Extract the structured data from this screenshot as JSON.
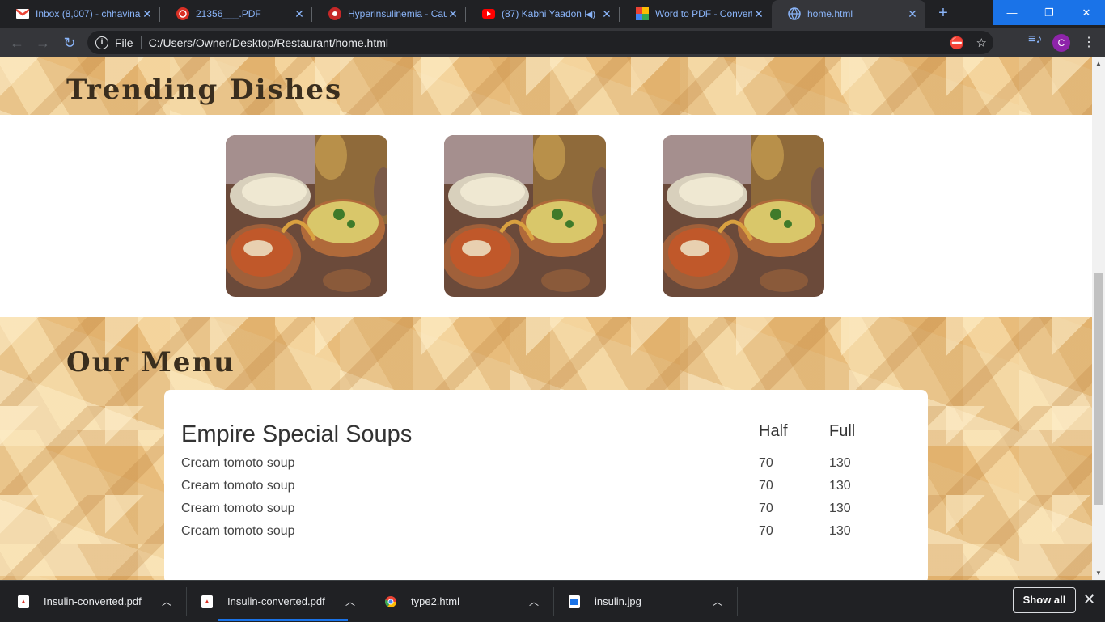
{
  "tabs": [
    {
      "title": "Inbox (8,007) - chhavina",
      "icon": "gmail-icon",
      "active": false
    },
    {
      "title": "21356___.PDF",
      "icon": "pdf-app-icon",
      "active": false
    },
    {
      "title": "Hyperinsulinemia - Cau",
      "icon": "health-site-icon",
      "active": false
    },
    {
      "title": "(87) Kabhi Yaadon M",
      "icon": "youtube-icon",
      "active": false
    },
    {
      "title": "Word to PDF - Convert",
      "icon": "converter-icon",
      "active": false
    },
    {
      "title": "home.html",
      "icon": "globe-icon",
      "active": true
    }
  ],
  "address_bar": {
    "scheme_label": "File",
    "url": "C:/Users/Owner/Desktop/Restaurant/home.html"
  },
  "profile_initial": "C",
  "page": {
    "trending_title": "Trending Dishes",
    "menu_title": "Our Menu",
    "menu": {
      "category": "Empire Special Soups",
      "columns": [
        "Half",
        "Full"
      ],
      "items": [
        {
          "name": "Cream tomoto soup",
          "half": "70",
          "full": "130"
        },
        {
          "name": "Cream tomoto soup",
          "half": "70",
          "full": "130"
        },
        {
          "name": "Cream tomoto soup",
          "half": "70",
          "full": "130"
        },
        {
          "name": "Cream tomoto soup",
          "half": "70",
          "full": "130"
        }
      ]
    }
  },
  "downloads": [
    {
      "name": "Insulin-converted.pdf",
      "icon": "pdf-file-icon"
    },
    {
      "name": "Insulin-converted.pdf",
      "icon": "pdf-file-icon"
    },
    {
      "name": "type2.html",
      "icon": "chrome-file-icon"
    },
    {
      "name": "insulin.jpg",
      "icon": "image-file-icon"
    }
  ],
  "show_all_label": "Show all"
}
